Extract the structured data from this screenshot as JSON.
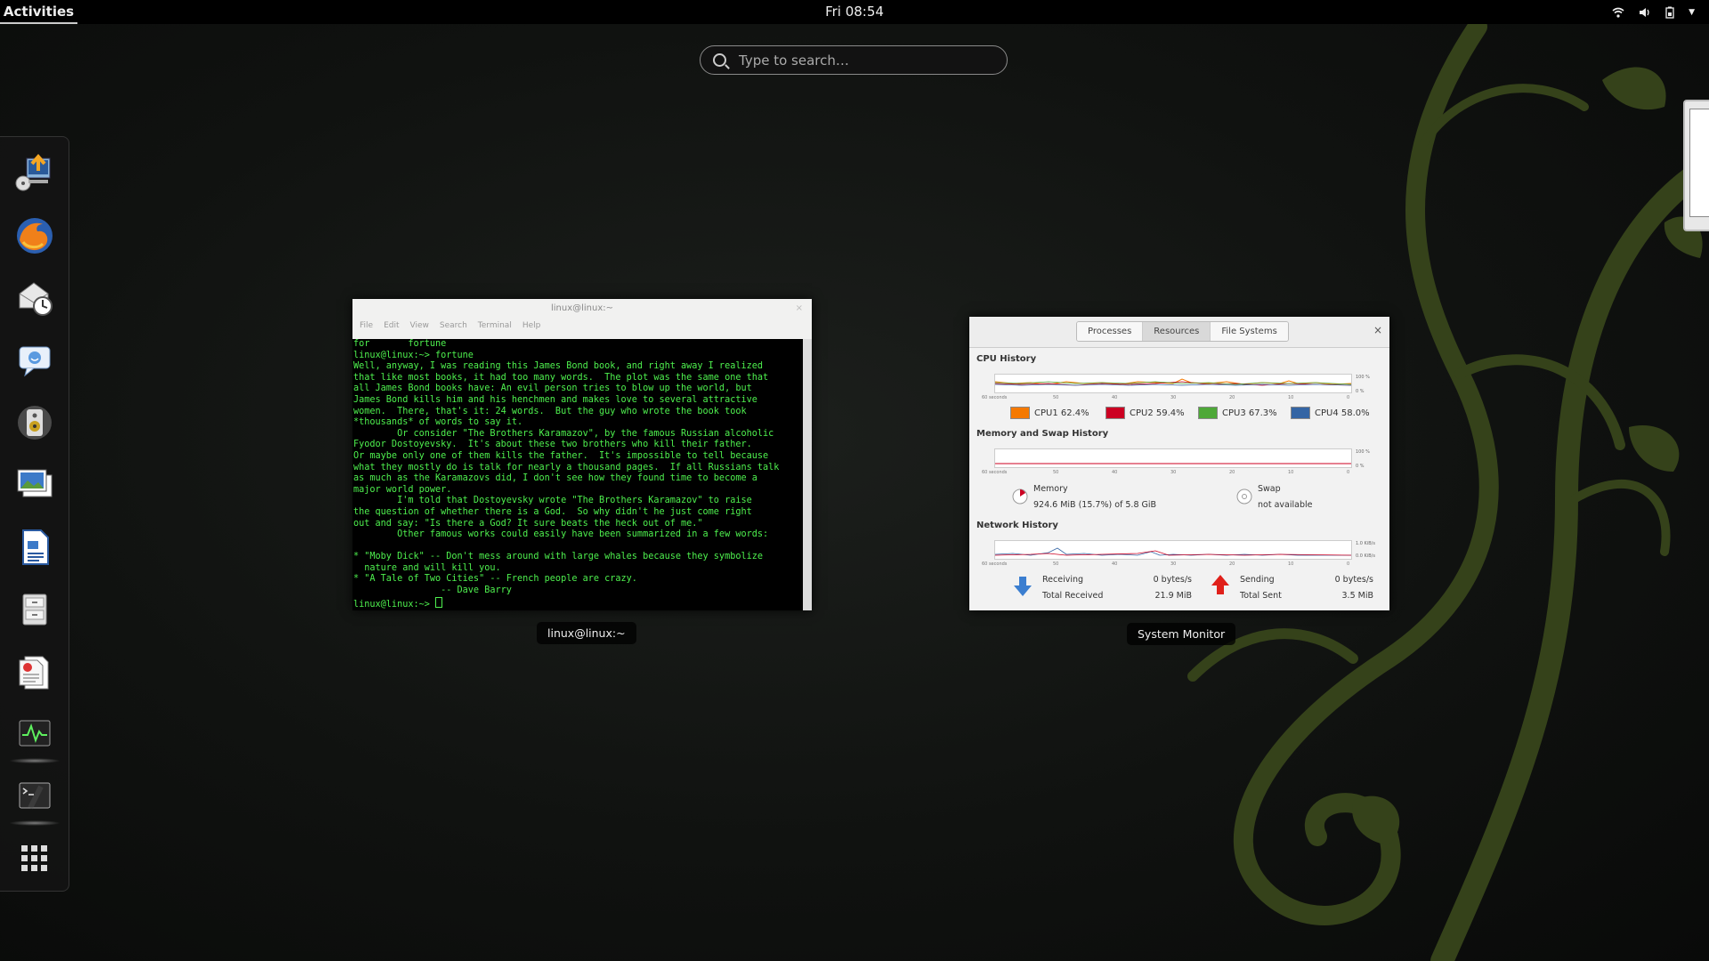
{
  "topbar": {
    "activities": "Activities",
    "clock": "Fri 08:54",
    "icons": [
      "wifi-icon",
      "volume-icon",
      "battery-icon",
      "chevron-down-icon"
    ]
  },
  "search": {
    "placeholder": "Type to search…"
  },
  "dash": {
    "items": [
      "install-icon",
      "firefox-icon",
      "evolution-icon",
      "empathy-icon",
      "rhythmbox-icon",
      "shotwell-icon",
      "writer-icon",
      "files-icon",
      "document-viewer-icon",
      "system-monitor-icon",
      "terminal-icon",
      "show-apps-icon"
    ]
  },
  "terminal_window": {
    "title": "linux@linux:~",
    "menu": [
      "File",
      "Edit",
      "View",
      "Search",
      "Terminal",
      "Help"
    ],
    "lines": [
      "for       fortune",
      "linux@linux:~> fortune",
      "Well, anyway, I was reading this James Bond book, and right away I realized",
      "that like most books, it had too many words.  The plot was the same one that",
      "all James Bond books have: An evil person tries to blow up the world, but",
      "James Bond kills him and his henchmen and makes love to several attractive",
      "women.  There, that's it: 24 words.  But the guy who wrote the book took",
      "*thousands* of words to say it.",
      "        Or consider \"The Brothers Karamazov\", by the famous Russian alcoholic",
      "Fyodor Dostoyevsky.  It's about these two brothers who kill their father.",
      "Or maybe only one of them kills the father.  It's impossible to tell because",
      "what they mostly do is talk for nearly a thousand pages.  If all Russians talk",
      "as much as the Karamazovs did, I don't see how they found time to become a",
      "major world power.",
      "        I'm told that Dostoyevsky wrote \"The Brothers Karamazov\" to raise",
      "the question of whether there is a God.  So why didn't he just come right",
      "out and say: \"Is there a God? It sure beats the heck out of me.\"",
      "        Other famous works could easily have been summarized in a few words:",
      "",
      "* \"Moby Dick\" -- Don't mess around with large whales because they symbolize",
      "  nature and will kill you.",
      "* \"A Tale of Two Cities\" -- French people are crazy.",
      "                -- Dave Barry"
    ],
    "prompt": "linux@linux:~> ",
    "caption": "linux@linux:~"
  },
  "sysmon_window": {
    "tabs": [
      "Processes",
      "Resources",
      "File Systems"
    ],
    "active_tab": "Resources",
    "close": "×",
    "cpu_title": "CPU History",
    "mem_title": "Memory and Swap History",
    "net_title": "Network History",
    "axis_labels": [
      "60 seconds",
      "50",
      "40",
      "30",
      "20",
      "10",
      "0"
    ],
    "cpu_y": [
      "100 %",
      "0 %"
    ],
    "mem_y": [
      "100 %",
      "0 %"
    ],
    "net_y": [
      "1.0 KiB/s",
      "0.0 KiB/s"
    ],
    "cpus": [
      {
        "label": "CPU1 62.4%",
        "color": "#f57900"
      },
      {
        "label": "CPU2 59.4%",
        "color": "#cc0022"
      },
      {
        "label": "CPU3 67.3%",
        "color": "#4ea838"
      },
      {
        "label": "CPU4 58.0%",
        "color": "#3465a4"
      }
    ],
    "memory_label": "Memory",
    "memory_value": "924.6 MiB (15.7%) of 5.8 GiB",
    "swap_label": "Swap",
    "swap_value": "not available",
    "receiving_label": "Receiving",
    "receiving_value": "0 bytes/s",
    "total_received_label": "Total Received",
    "total_received_value": "21.9 MiB",
    "sending_label": "Sending",
    "sending_value": "0 bytes/s",
    "total_sent_label": "Total Sent",
    "total_sent_value": "3.5 MiB",
    "caption": "System Monitor"
  },
  "colors": {
    "terminal_text": "#4ef04e",
    "accent_vine": "#3c4a1c"
  }
}
